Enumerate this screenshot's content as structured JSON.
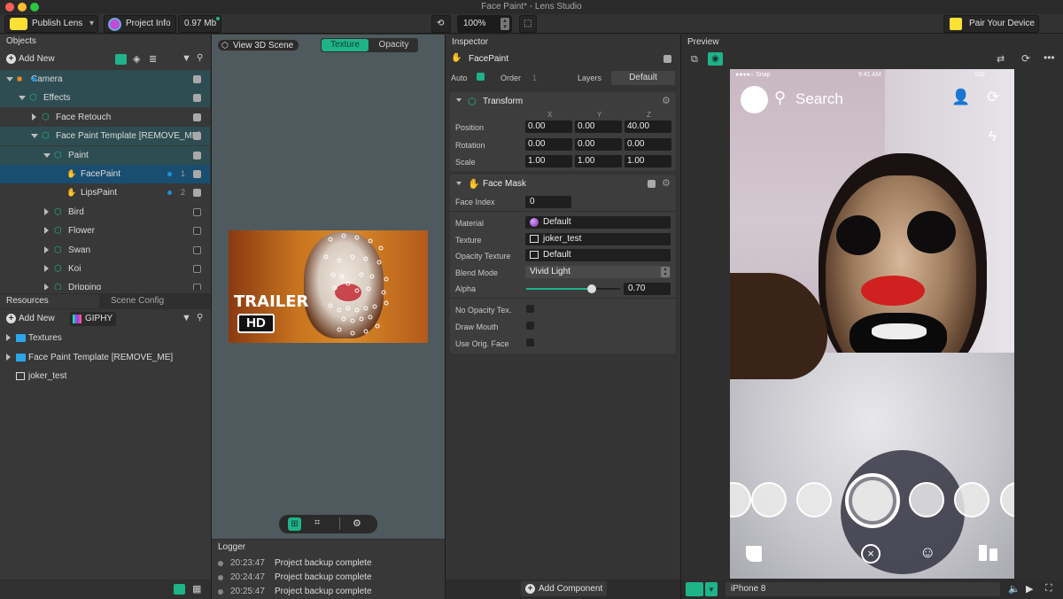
{
  "window": {
    "title": "Face Paint* - Lens Studio"
  },
  "toolbar": {
    "publish": "Publish Lens",
    "project_info": "Project Info",
    "size": "0.97 Mb",
    "zoom": "100%",
    "pair": "Pair Your Device"
  },
  "objects": {
    "title": "Objects",
    "add_new": "Add New",
    "items": [
      {
        "label": "Camera"
      },
      {
        "label": "Effects"
      },
      {
        "label": "Face Retouch"
      },
      {
        "label": "Face Paint Template [REMOVE_ME]"
      },
      {
        "label": "Paint"
      },
      {
        "label": "FacePaint",
        "order": "1"
      },
      {
        "label": "LipsPaint",
        "order": "2"
      },
      {
        "label": "Bird"
      },
      {
        "label": "Flower"
      },
      {
        "label": "Swan"
      },
      {
        "label": "Koi"
      },
      {
        "label": "Dripping"
      }
    ]
  },
  "resources": {
    "tab": "Resources",
    "tab2": "Scene Config",
    "add_new": "Add New",
    "giphy": "GIPHY",
    "items": [
      {
        "label": "Textures"
      },
      {
        "label": "Face Paint Template [REMOVE_ME]"
      },
      {
        "label": "joker_test"
      }
    ]
  },
  "viewport": {
    "view3d": "View 3D Scene",
    "tab_texture": "Texture",
    "tab_opacity": "Opacity",
    "trailer": "TRAILER",
    "hd": "HD"
  },
  "logger": {
    "title": "Logger",
    "entries": [
      {
        "time": "20:23:47",
        "text": "Project backup complete"
      },
      {
        "time": "20:24:47",
        "text": "Project backup complete"
      },
      {
        "time": "20:25:47",
        "text": "Project backup complete"
      }
    ]
  },
  "inspector": {
    "title": "Inspector",
    "object": "FacePaint",
    "auto": "Auto",
    "order": "Order",
    "order_val": "1",
    "layers": "Layers",
    "layers_val": "Default",
    "transform": {
      "title": "Transform",
      "x": "X",
      "y": "Y",
      "z": "Z",
      "position": {
        "label": "Position",
        "v": [
          "0.00",
          "0.00",
          "40.00"
        ]
      },
      "rotation": {
        "label": "Rotation",
        "v": [
          "0.00",
          "0.00",
          "0.00"
        ]
      },
      "scale": {
        "label": "Scale",
        "v": [
          "1.00",
          "1.00",
          "1.00"
        ]
      }
    },
    "facemask": {
      "title": "Face Mask",
      "face_index": "Face Index",
      "face_index_val": "0",
      "material": "Material",
      "material_val": "Default",
      "texture": "Texture",
      "texture_val": "joker_test",
      "opacity_tex": "Opacity Texture",
      "opacity_tex_val": "Default",
      "blend": "Blend Mode",
      "blend_val": "Vivid Light",
      "alpha": "Alpha",
      "alpha_val": "0.70",
      "alpha_level": 0.7,
      "no_opacity": "No Opacity Tex.",
      "draw_mouth": "Draw Mouth",
      "use_orig": "Use Orig. Face"
    },
    "add_component": "Add Component"
  },
  "preview": {
    "title": "Preview",
    "carrier": "Snap",
    "time": "9:41 AM",
    "battery": "100",
    "search": "Search",
    "device": "iPhone 8"
  },
  "colors": {
    "accent": "#1fb389",
    "selection": "#1a4e70",
    "teal_row": "#2d4d52"
  }
}
